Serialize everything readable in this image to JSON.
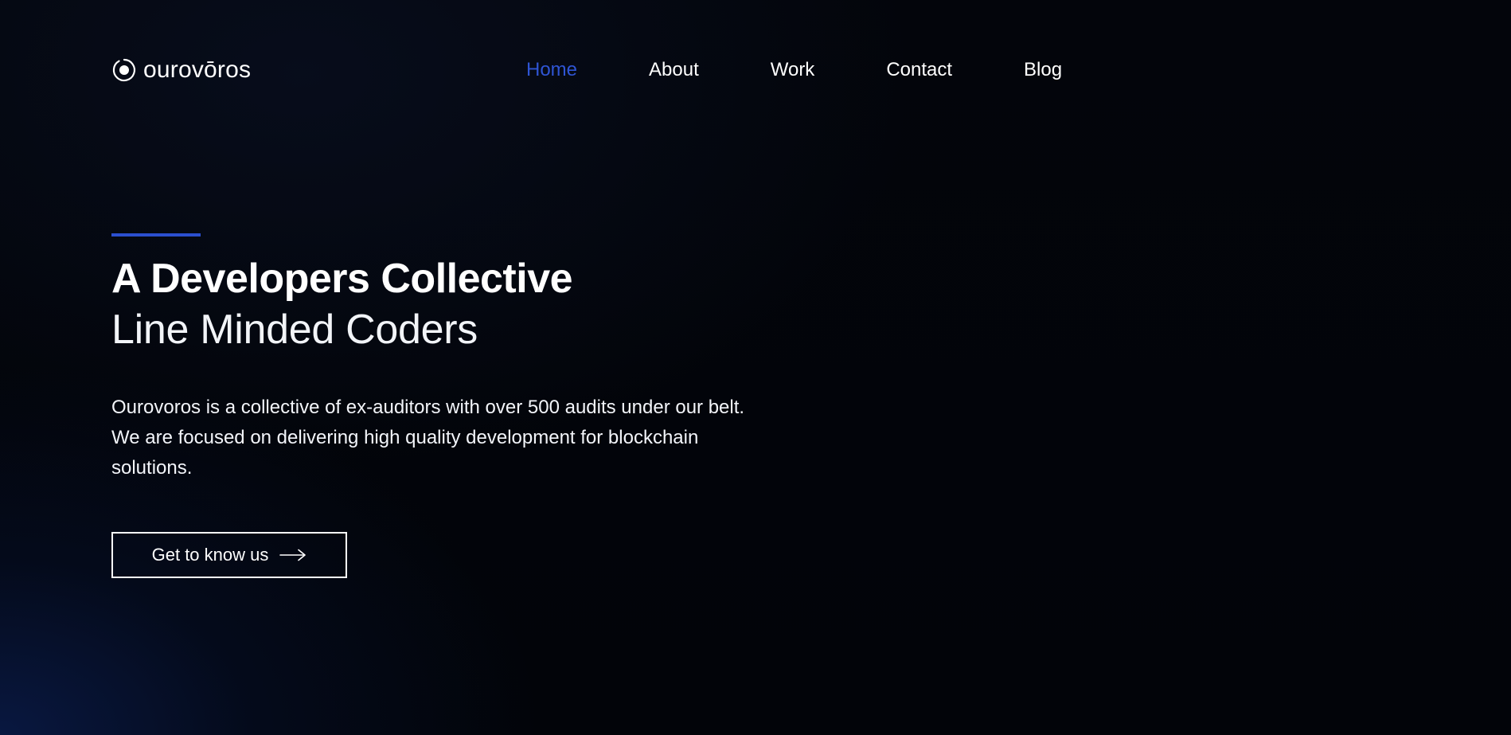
{
  "header": {
    "logo_text": "ourovōros",
    "logo_icon": "circle-dot-logo-icon",
    "nav": [
      {
        "label": "Home",
        "active": true
      },
      {
        "label": "About",
        "active": false
      },
      {
        "label": "Work",
        "active": false
      },
      {
        "label": "Contact",
        "active": false
      },
      {
        "label": "Blog",
        "active": false
      }
    ]
  },
  "hero": {
    "headline_strong": "A Developers Collective",
    "headline_light": "Line Minded Coders",
    "intro": "Ourovoros is a collective of ex-auditors with over 500 audits under our belt. We are focused on delivering high quality development for blockchain solutions.",
    "cta_label": "Get to know us",
    "cta_icon": "arrow-right-icon"
  },
  "colors": {
    "accent": "#2b4fcf",
    "nav_active": "#2f55d4",
    "background": "#020409",
    "text": "#ffffff"
  }
}
